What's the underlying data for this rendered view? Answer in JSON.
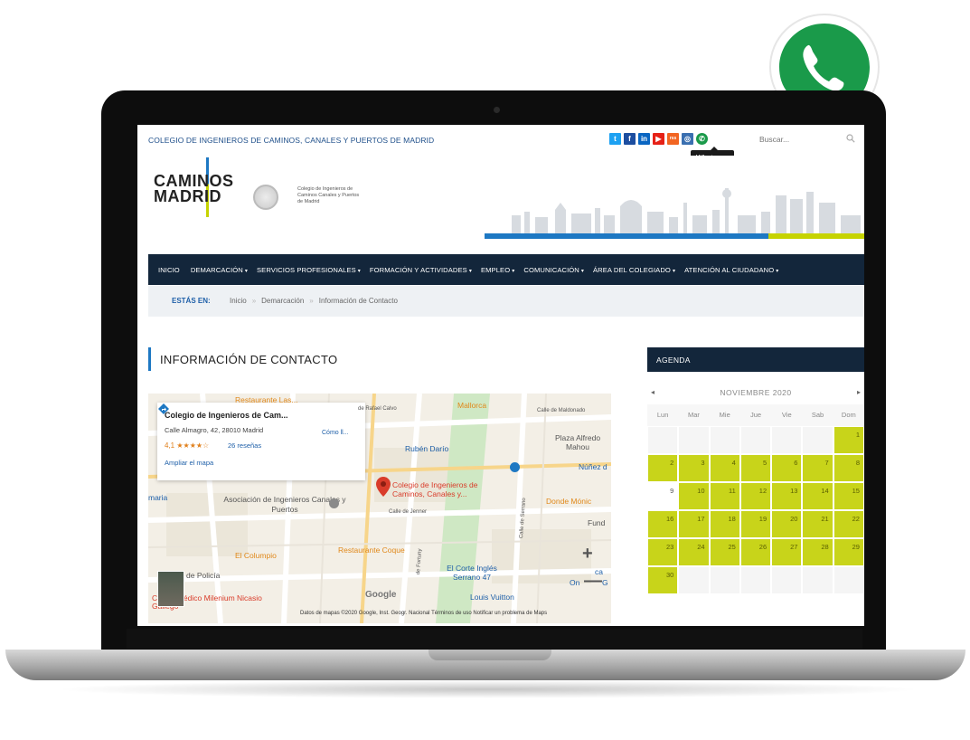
{
  "site": {
    "topbar_title": "COLEGIO DE INGENIEROS DE CAMINOS, CANALES Y PUERTOS DE MADRID",
    "social": [
      "t",
      "f",
      "in",
      "▶",
      "rss",
      "◎",
      "✆"
    ],
    "search_placeholder": "Buscar...",
    "tooltip": "Whatsapp",
    "logo": {
      "line1": "CAMINOS",
      "line2": "MADRID",
      "caption": "Colegio de Ingenieros de Caminos Canales y Puertos de Madrid"
    },
    "nav": [
      {
        "label": "INICIO",
        "chevron": ""
      },
      {
        "label": "DEMARCACIÓN",
        "chevron": "▾"
      },
      {
        "label": "SERVICIOS PROFESIONALES",
        "chevron": "▾"
      },
      {
        "label": "FORMACIÓN Y ACTIVIDADES",
        "chevron": "▾"
      },
      {
        "label": "EMPLEO",
        "chevron": "▾"
      },
      {
        "label": "COMUNICACIÓN",
        "chevron": "▾"
      },
      {
        "label": "ÁREA DEL COLEGIADO",
        "chevron": "▾"
      },
      {
        "label": "ATENCIÓN AL CIUDADANO",
        "chevron": "▾"
      }
    ],
    "breadcrumb": {
      "label": "ESTÁS EN:",
      "items": [
        "Inicio",
        "Demarcación",
        "Información de Contacto"
      ],
      "separator": "»"
    },
    "page_title": "INFORMACIÓN DE CONTACTO"
  },
  "map": {
    "card": {
      "name": "Colegio de Ingenieros de Cam...",
      "address": "Calle Almagro, 42, 28010 Madrid",
      "rating": "4,1 ★★★★☆",
      "reviews": "26 reseñas",
      "enlarge": "Ampliar el mapa",
      "directions": "Cómo ll..."
    },
    "pois": {
      "restaurant_top": "Restaurante Las...",
      "mallorca": "Mallorca",
      "street_rafael": "de Rafael Calvo",
      "street_maldonado": "Calle de Maldonado",
      "ruben_dario": "Rubén Darío",
      "plaza": "Plaza Alfredo Mahou",
      "nunez": "Núñez d",
      "colegio": "Colegio de Ingenieros de Caminos, Canales y...",
      "asociacion": "Asociación de Ingenieros Canales y Puertos",
      "maria": "maria",
      "calle_jenner": "Calle de Jenner",
      "donde_monica": "Donde Mónic",
      "fund": "Fund",
      "serrano": "Calle de Serrano",
      "el_columpio": "El Columpio",
      "restaurante_coque": "Restaurante Coque",
      "fortuny": "de Fortuny",
      "corte_ingles": "El Corte Inglés Serrano 47",
      "louis_vuitton": "Louis Vuitton",
      "de_policia": "de Policía",
      "centro_medico": "Centro Médico Milenium Nicasio Gallego",
      "google": "Google",
      "attribution": "Datos de mapas ©2020 Google, Inst. Geogr. Nacional   Términos de uso   Notificar un problema de Maps",
      "zoom_in": "+",
      "zoom_out": "—",
      "ca": "ca",
      "g": "G",
      "on": "On"
    }
  },
  "agenda": {
    "title": "AGENDA",
    "month": "NOVIEMBRE 2020",
    "prev": "◂",
    "next": "▸",
    "weekdays": [
      "Lun",
      "Mar",
      "Mie",
      "Jue",
      "Vie",
      "Sab",
      "Dom"
    ],
    "weeks": [
      [
        "",
        "",
        "",
        "",
        "",
        "",
        "1"
      ],
      [
        "2",
        "3",
        "4",
        "5",
        "6",
        "7",
        "8"
      ],
      [
        "9",
        "10",
        "11",
        "12",
        "13",
        "14",
        "15"
      ],
      [
        "16",
        "17",
        "18",
        "19",
        "20",
        "21",
        "22"
      ],
      [
        "23",
        "24",
        "25",
        "26",
        "27",
        "28",
        "29"
      ],
      [
        "30",
        "",
        "",
        "",
        "",
        "",
        ""
      ]
    ],
    "plain_days": [
      "9"
    ],
    "highlight_color": "#c8d41a"
  },
  "colors": {
    "nav_bg": "#13263b",
    "accent_blue": "#1e78c3",
    "accent_green": "#c6d300",
    "whatsapp": "#1a9a4a"
  }
}
